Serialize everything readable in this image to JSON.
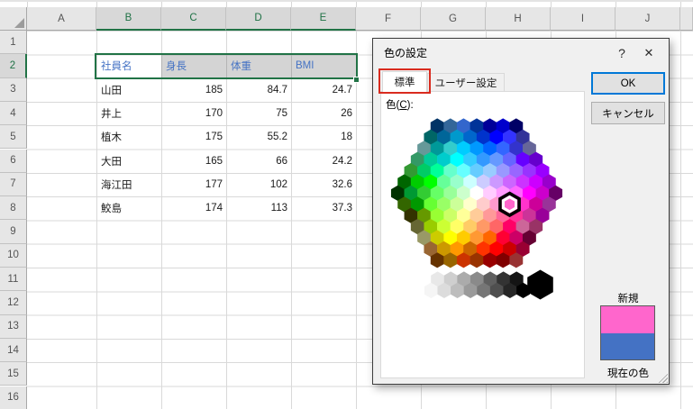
{
  "sheet": {
    "column_headers": [
      "A",
      "B",
      "C",
      "D",
      "E",
      "F",
      "G",
      "H",
      "I",
      "J",
      ""
    ],
    "row_headers": [
      "1",
      "2",
      "3",
      "4",
      "5",
      "6",
      "7",
      "8",
      "9",
      "10",
      "11",
      "12",
      "13",
      "14",
      "15",
      "16"
    ],
    "table": {
      "header_cells": [
        "社員名",
        "身長",
        "体重",
        "BMI"
      ],
      "rows": [
        [
          "山田",
          "185",
          "84.7",
          "24.7"
        ],
        [
          "井上",
          "170",
          "75",
          "26"
        ],
        [
          "植木",
          "175",
          "55.2",
          "18"
        ],
        [
          "大田",
          "165",
          "66",
          "24.2"
        ],
        [
          "海江田",
          "177",
          "102",
          "32.6"
        ],
        [
          "鮫島",
          "174",
          "113",
          "37.3"
        ]
      ]
    },
    "selection": {
      "range": "B2:E2",
      "active_cell": "B2"
    },
    "colors": {
      "table_header_text": "#4472C4",
      "selection_border": "#217346",
      "selected_header_text": "#1E7145"
    }
  },
  "dialog": {
    "title": "色の設定",
    "help_button": "?",
    "close_button": "✕",
    "tabs": [
      {
        "label": "標準",
        "active": true,
        "annotated": true
      },
      {
        "label": "ユーザー設定",
        "active": false
      }
    ],
    "color_label_parts": {
      "pre": "色(",
      "accel": "C",
      "post": "):"
    },
    "buttons": {
      "ok": "OK",
      "cancel": "キャンセル"
    },
    "swatch": {
      "new_label": "新規",
      "current_label": "現在の色",
      "new_color": "#FF66CC",
      "current_color": "#4472C4"
    },
    "selected_color": "#FF66CC",
    "selected_hex": {
      "row": 7,
      "index": 8
    },
    "annotation_color": "#D92B1F",
    "palette_rows": [
      [
        "#003366",
        "#336699",
        "#3366CC",
        "#003399",
        "#000099",
        "#0000CC",
        "#000066"
      ],
      [
        "#006666",
        "#006699",
        "#0099CC",
        "#0066CC",
        "#0033CC",
        "#0000FF",
        "#3333FF",
        "#333399"
      ],
      [
        "#669999",
        "#009999",
        "#33CCCC",
        "#00CCFF",
        "#0099FF",
        "#0066FF",
        "#3366FF",
        "#3333CC",
        "#666699"
      ],
      [
        "#339966",
        "#00CC99",
        "#00CCCC",
        "#00FFFF",
        "#33CCFF",
        "#3399FF",
        "#6699FF",
        "#6666FF",
        "#6600FF",
        "#6600CC"
      ],
      [
        "#339933",
        "#00CC66",
        "#00FF99",
        "#66FFCC",
        "#66FFFF",
        "#66CCFF",
        "#99CCFF",
        "#9999FF",
        "#9966FF",
        "#9933FF",
        "#9900FF"
      ],
      [
        "#006600",
        "#00CC00",
        "#00FF00",
        "#66FF99",
        "#99FFCC",
        "#CCFFFF",
        "#CCCCFF",
        "#CC99FF",
        "#CC66FF",
        "#CC33FF",
        "#CC00FF",
        "#9900CC"
      ],
      [
        "#003300",
        "#009933",
        "#33CC33",
        "#66FF66",
        "#99FF99",
        "#CCFFCC",
        "#FFFFFF",
        "#FFCCFF",
        "#FF99FF",
        "#FF66FF",
        "#FF00FF",
        "#CC00CC",
        "#660066"
      ],
      [
        "#336600",
        "#009900",
        "#66FF33",
        "#99FF66",
        "#CCFF99",
        "#FFFFCC",
        "#FFCCCC",
        "#FF99CC",
        "#FF66CC",
        "#FF33CC",
        "#CC0099",
        "#993399"
      ],
      [
        "#333300",
        "#669900",
        "#99FF33",
        "#CCFF66",
        "#FFFF99",
        "#FFCC99",
        "#FF9999",
        "#FF6699",
        "#FF3399",
        "#CC3399",
        "#990099"
      ],
      [
        "#666633",
        "#99CC00",
        "#CCFF33",
        "#FFFF66",
        "#FFCC66",
        "#FF9966",
        "#FF6666",
        "#FF0066",
        "#CC6699",
        "#993366"
      ],
      [
        "#999966",
        "#CCCC00",
        "#FFFF00",
        "#FFCC00",
        "#FF9933",
        "#FF6600",
        "#FF0033",
        "#CC0066",
        "#660033"
      ],
      [
        "#996633",
        "#CC9900",
        "#FF9900",
        "#CC6600",
        "#FF3300",
        "#FF0000",
        "#CC0000",
        "#990033"
      ],
      [
        "#663300",
        "#996600",
        "#CC3300",
        "#993300",
        "#990000",
        "#800000",
        "#993333"
      ]
    ],
    "gray_rows": [
      [
        "#FFFFFF",
        "#E8E8E8",
        "#CFCFCF",
        "#ABABAB",
        "#8A8A8A",
        "#5F5F5F",
        "#333333",
        "#141414"
      ],
      [
        "#F5F5F5",
        "#DCDCDC",
        "#BDBDBD",
        "#9A9A9A",
        "#767676",
        "#4F4F4F",
        "#262626",
        "#000000"
      ]
    ],
    "big_black_hex": "#000000"
  }
}
